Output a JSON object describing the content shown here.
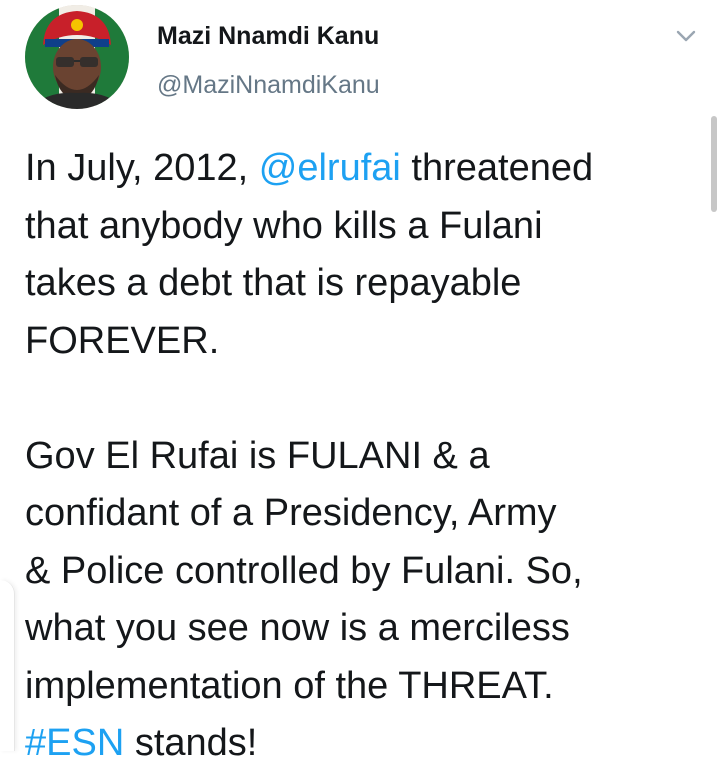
{
  "tweet": {
    "author": {
      "display_name": "Mazi Nnamdi Kanu",
      "handle": "@MaziNnamdiKanu",
      "avatar": "profile-photo"
    },
    "menu_icon": "chevron-down-icon",
    "body": {
      "line1_prefix": "In July, 2012, ",
      "mention": "@elrufai",
      "line1_suffix": " threatened",
      "line2": "that anybody who kills a Fulani",
      "line3": "takes a debt that is repayable",
      "line4": "FOREVER.",
      "line5": "Gov El Rufai is FULANI & a",
      "line6": "confidant of a Presidency, Army",
      "line7": "& Police controlled by Fulani. So,",
      "line8": "what you see now is a merciless",
      "line9": "implementation of the THREAT.",
      "hashtag": "#ESN",
      "line10_suffix": " stands!"
    }
  },
  "colors": {
    "link": "#1da1f2",
    "text": "#14171a",
    "secondary": "#657786"
  }
}
